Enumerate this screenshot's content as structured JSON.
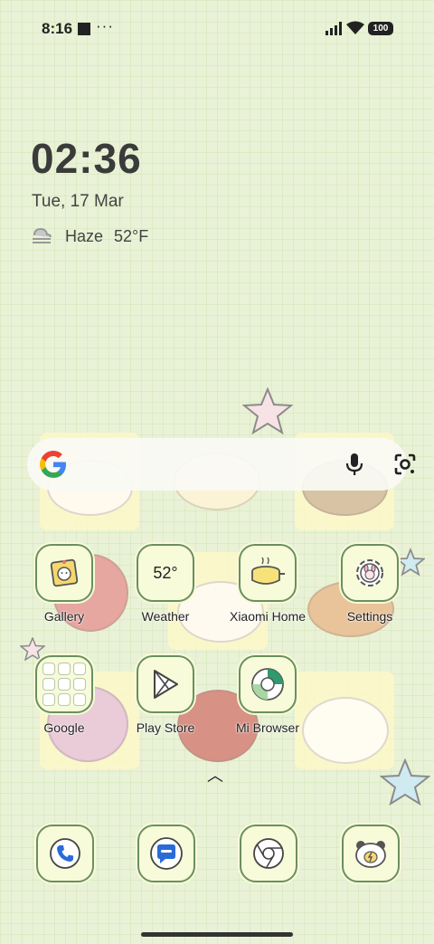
{
  "status_bar": {
    "time": "8:16",
    "dots": "···",
    "battery": "100",
    "icons": [
      "notification-square-icon",
      "signal-icon",
      "wifi-icon",
      "battery-icon"
    ]
  },
  "clock_widget": {
    "time": "02:36",
    "date": "Tue, 17 Mar",
    "weather_condition": "Haze",
    "weather_temp": "52°F",
    "weather_icon": "haze-icon"
  },
  "search_bar": {
    "icons": [
      "google-logo-icon",
      "mic-icon",
      "lens-icon"
    ]
  },
  "apps": {
    "gallery": {
      "label": "Gallery",
      "icon": "gallery-icon"
    },
    "weather": {
      "label": "Weather",
      "temp": "52°",
      "icon": "weather-icon"
    },
    "xiaomi_home": {
      "label": "Xiaomi Home",
      "icon": "xiaomi-home-icon"
    },
    "settings": {
      "label": "Settings",
      "icon": "settings-icon"
    },
    "google": {
      "label": "Google",
      "icon": "folder-icon"
    },
    "play_store": {
      "label": "Play Store",
      "icon": "play-store-icon"
    },
    "mi_browser": {
      "label": "Mi Browser",
      "icon": "mi-browser-icon"
    }
  },
  "dock": {
    "icons": [
      "phone-icon",
      "messages-icon",
      "chrome-icon",
      "cleaner-icon"
    ]
  },
  "colors": {
    "background": "#e9f2d6",
    "icon_border": "#6b8f5f",
    "icon_fill": "#f7fbd9"
  }
}
